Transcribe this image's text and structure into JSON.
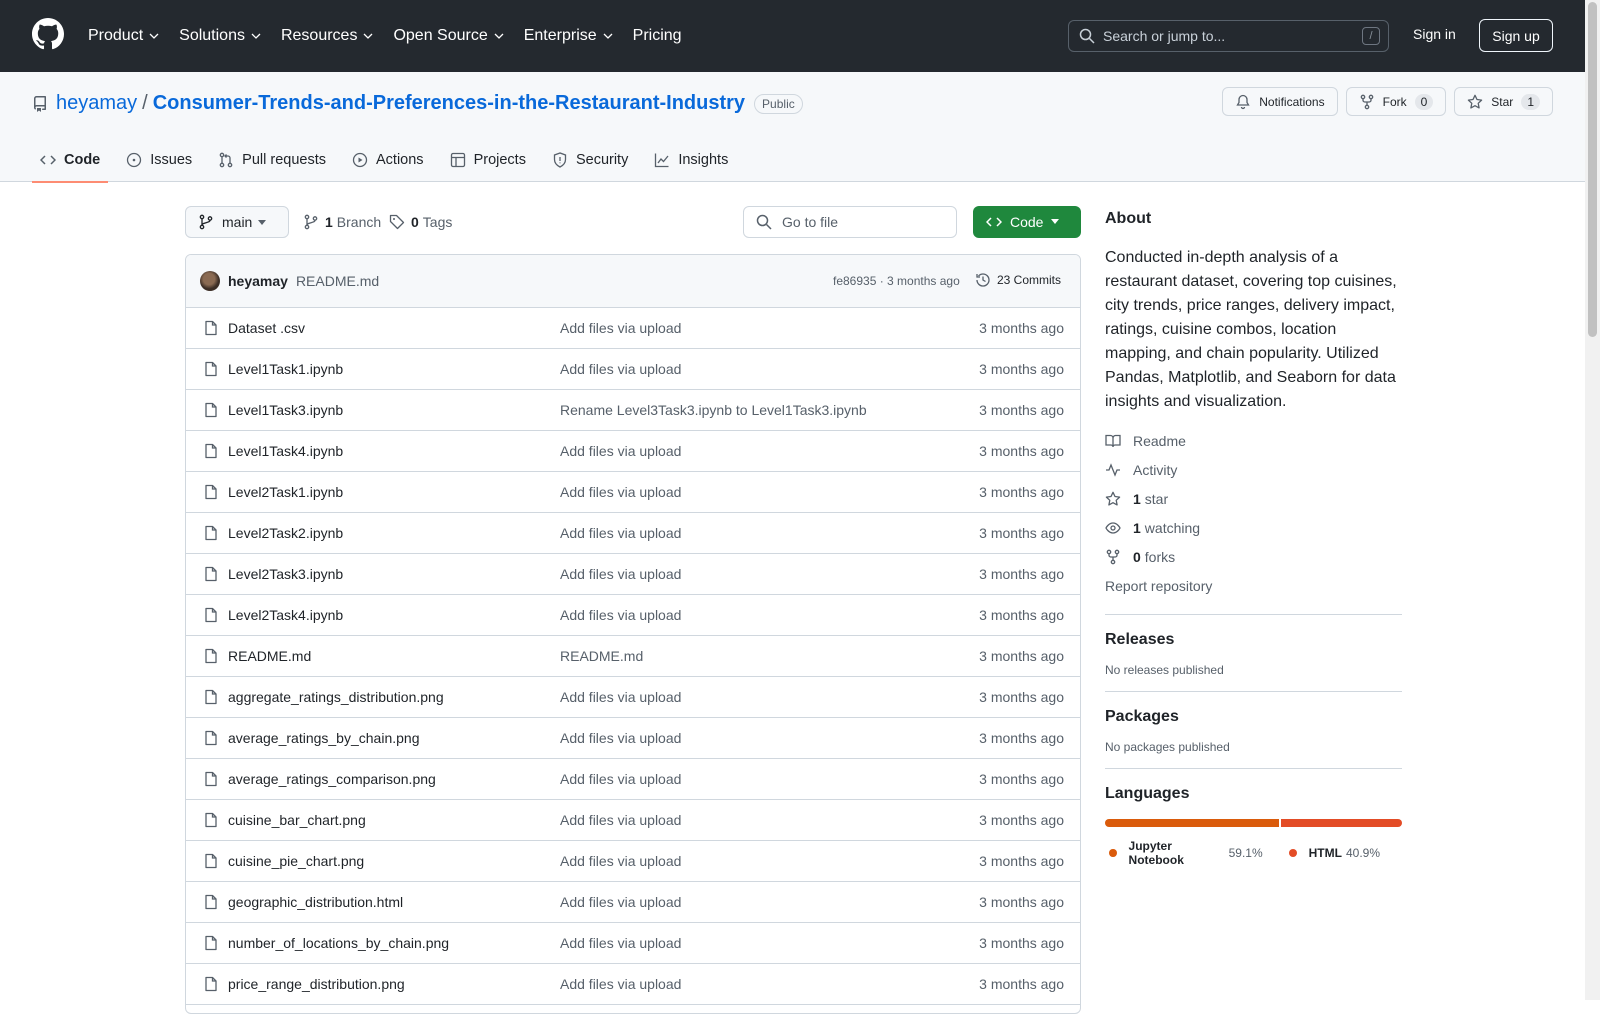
{
  "header": {
    "nav": [
      "Product",
      "Solutions",
      "Resources",
      "Open Source",
      "Enterprise",
      "Pricing"
    ],
    "search_placeholder": "Search or jump to...",
    "search_shortcut": "/",
    "signin": "Sign in",
    "signup": "Sign up"
  },
  "repo": {
    "owner": "heyamay",
    "separator": "/",
    "name": "Consumer-Trends-and-Preferences-in-the-Restaurant-Industry",
    "visibility": "Public",
    "notifications_label": "Notifications",
    "fork_label": "Fork",
    "fork_count": "0",
    "star_label": "Star",
    "star_count": "1"
  },
  "tabs": [
    {
      "label": "Code",
      "icon": "code-icon",
      "active": true
    },
    {
      "label": "Issues",
      "icon": "issue-icon"
    },
    {
      "label": "Pull requests",
      "icon": "pull-request-icon"
    },
    {
      "label": "Actions",
      "icon": "play-icon"
    },
    {
      "label": "Projects",
      "icon": "table-icon"
    },
    {
      "label": "Security",
      "icon": "shield-icon"
    },
    {
      "label": "Insights",
      "icon": "graph-icon"
    }
  ],
  "toolbar": {
    "branch": "main",
    "branch_count": "1",
    "branch_label": "Branch",
    "tag_count": "0",
    "tag_label": "Tags",
    "goto_placeholder": "Go to file",
    "code_label": "Code"
  },
  "commit": {
    "user": "heyamay",
    "message": "README.md",
    "meta": "fe86935 · 3 months ago",
    "count": "23 Commits"
  },
  "files": [
    {
      "name": "Dataset .csv",
      "msg": "Add files via upload",
      "date": "3 months ago"
    },
    {
      "name": "Level1Task1.ipynb",
      "msg": "Add files via upload",
      "date": "3 months ago"
    },
    {
      "name": "Level1Task3.ipynb",
      "msg": "Rename Level3Task3.ipynb to Level1Task3.ipynb",
      "date": "3 months ago"
    },
    {
      "name": "Level1Task4.ipynb",
      "msg": "Add files via upload",
      "date": "3 months ago"
    },
    {
      "name": "Level2Task1.ipynb",
      "msg": "Add files via upload",
      "date": "3 months ago"
    },
    {
      "name": "Level2Task2.ipynb",
      "msg": "Add files via upload",
      "date": "3 months ago"
    },
    {
      "name": "Level2Task3.ipynb",
      "msg": "Add files via upload",
      "date": "3 months ago"
    },
    {
      "name": "Level2Task4.ipynb",
      "msg": "Add files via upload",
      "date": "3 months ago"
    },
    {
      "name": "README.md",
      "msg": "README.md",
      "date": "3 months ago"
    },
    {
      "name": "aggregate_ratings_distribution.png",
      "msg": "Add files via upload",
      "date": "3 months ago"
    },
    {
      "name": "average_ratings_by_chain.png",
      "msg": "Add files via upload",
      "date": "3 months ago"
    },
    {
      "name": "average_ratings_comparison.png",
      "msg": "Add files via upload",
      "date": "3 months ago"
    },
    {
      "name": "cuisine_bar_chart.png",
      "msg": "Add files via upload",
      "date": "3 months ago"
    },
    {
      "name": "cuisine_pie_chart.png",
      "msg": "Add files via upload",
      "date": "3 months ago"
    },
    {
      "name": "geographic_distribution.html",
      "msg": "Add files via upload",
      "date": "3 months ago"
    },
    {
      "name": "number_of_locations_by_chain.png",
      "msg": "Add files via upload",
      "date": "3 months ago"
    },
    {
      "name": "price_range_distribution.png",
      "msg": "Add files via upload",
      "date": "3 months ago"
    }
  ],
  "about": {
    "title": "About",
    "description": "Conducted in-depth analysis of a restaurant dataset, covering top cuisines, city trends, price ranges, delivery impact, ratings, cuisine combos, location mapping, and chain popularity. Utilized Pandas, Matplotlib, and Seaborn for data insights and visualization.",
    "readme": "Readme",
    "activity": "Activity",
    "stars_count": "1",
    "stars_label": "star",
    "watching_count": "1",
    "watching_label": "watching",
    "forks_count": "0",
    "forks_label": "forks",
    "report": "Report repository"
  },
  "releases": {
    "title": "Releases",
    "empty": "No releases published"
  },
  "packages": {
    "title": "Packages",
    "empty": "No packages published"
  },
  "languages": {
    "title": "Languages",
    "items": [
      {
        "name": "Jupyter Notebook",
        "pct_label": "59.1%",
        "pct": 59.1,
        "color": "#DA5B0B"
      },
      {
        "name": "HTML",
        "pct_label": "40.9%",
        "pct": 40.9,
        "color": "#e34c26"
      }
    ]
  }
}
